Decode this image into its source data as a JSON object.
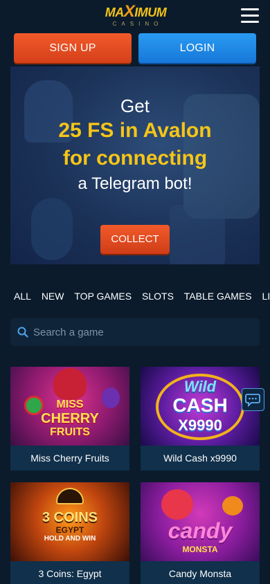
{
  "header": {
    "logo_main_left": "MA",
    "logo_main_x": "X",
    "logo_main_right": "IMUM",
    "logo_sub": "CASINO"
  },
  "auth": {
    "signup_label": "SIGN UP",
    "login_label": "LOGIN"
  },
  "banner": {
    "line1": "Get",
    "line2": "25 FS in Avalon",
    "line3": "for connecting",
    "line4": "a Telegram bot!",
    "collect_label": "COLLECT"
  },
  "categories": [
    "ALL",
    "NEW",
    "TOP GAMES",
    "SLOTS",
    "TABLE GAMES",
    "LIVE SH"
  ],
  "search": {
    "placeholder": "Search a game"
  },
  "games": [
    {
      "title": "Miss Cherry Fruits",
      "art": [
        "MISS",
        "CHERRY",
        "FRUITS"
      ]
    },
    {
      "title": "Wild Cash x9990",
      "art": [
        "Wild",
        "CASH",
        "X9990"
      ]
    },
    {
      "title": "3 Coins: Egypt",
      "art": [
        "3 COINS",
        "EGYPT",
        "HOLD AND WIN"
      ]
    },
    {
      "title": "Candy Monsta",
      "art": [
        "candy",
        "MONSTA"
      ]
    }
  ],
  "colors": {
    "background": "#0b1b2c",
    "accent_orange": "#e84d20",
    "accent_blue": "#1f8ae8",
    "highlight_yellow": "#f5c518"
  },
  "icons": {
    "menu": "hamburger-menu-icon",
    "search": "search-icon",
    "chat": "chat-icon"
  }
}
